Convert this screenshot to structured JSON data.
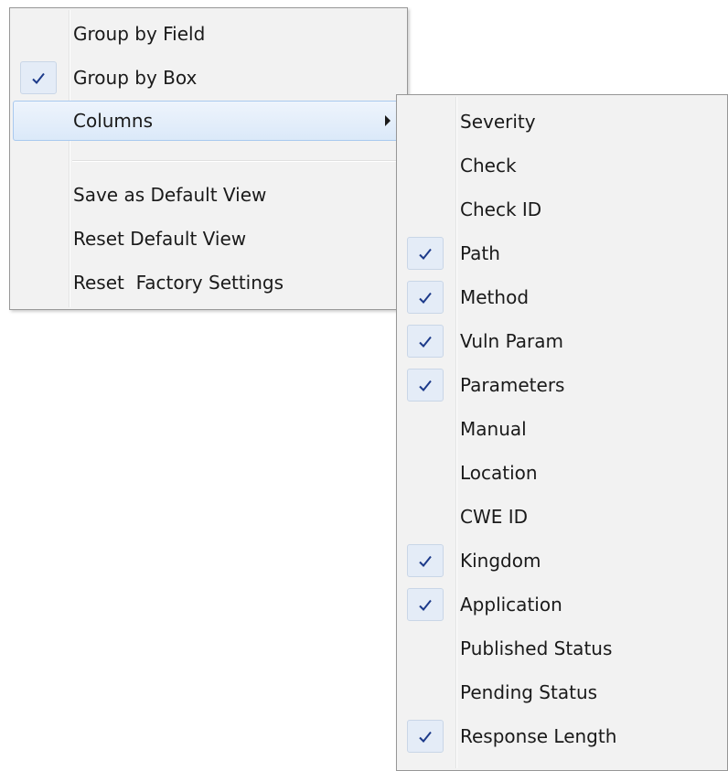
{
  "main_menu": {
    "items": [
      {
        "label": "Group by Field",
        "checked": false
      },
      {
        "label": "Group by Box",
        "checked": true
      },
      {
        "label": "Columns",
        "checked": false,
        "has_submenu": true,
        "highlighted": true
      }
    ],
    "items_after_separator": [
      {
        "label": "Save as Default View"
      },
      {
        "label": "Reset Default View"
      },
      {
        "label": "Reset  Factory Settings"
      }
    ]
  },
  "columns_submenu": {
    "items": [
      {
        "label": "Severity",
        "checked": false
      },
      {
        "label": "Check",
        "checked": false
      },
      {
        "label": "Check ID",
        "checked": false
      },
      {
        "label": "Path",
        "checked": true
      },
      {
        "label": "Method",
        "checked": true
      },
      {
        "label": "Vuln Param",
        "checked": true
      },
      {
        "label": "Parameters",
        "checked": true
      },
      {
        "label": "Manual",
        "checked": false
      },
      {
        "label": "Location",
        "checked": false
      },
      {
        "label": "CWE ID",
        "checked": false
      },
      {
        "label": "Kingdom",
        "checked": true
      },
      {
        "label": "Application",
        "checked": true
      },
      {
        "label": "Published Status",
        "checked": false
      },
      {
        "label": "Pending Status",
        "checked": false
      },
      {
        "label": "Response Length",
        "checked": true
      }
    ]
  },
  "colors": {
    "menu_background": "#f2f2f2",
    "check_color": "#1c3a8a",
    "highlight_border": "#a9c9ef"
  },
  "icons": {
    "check": "checkmark-icon",
    "submenu": "submenu-arrow-icon"
  }
}
